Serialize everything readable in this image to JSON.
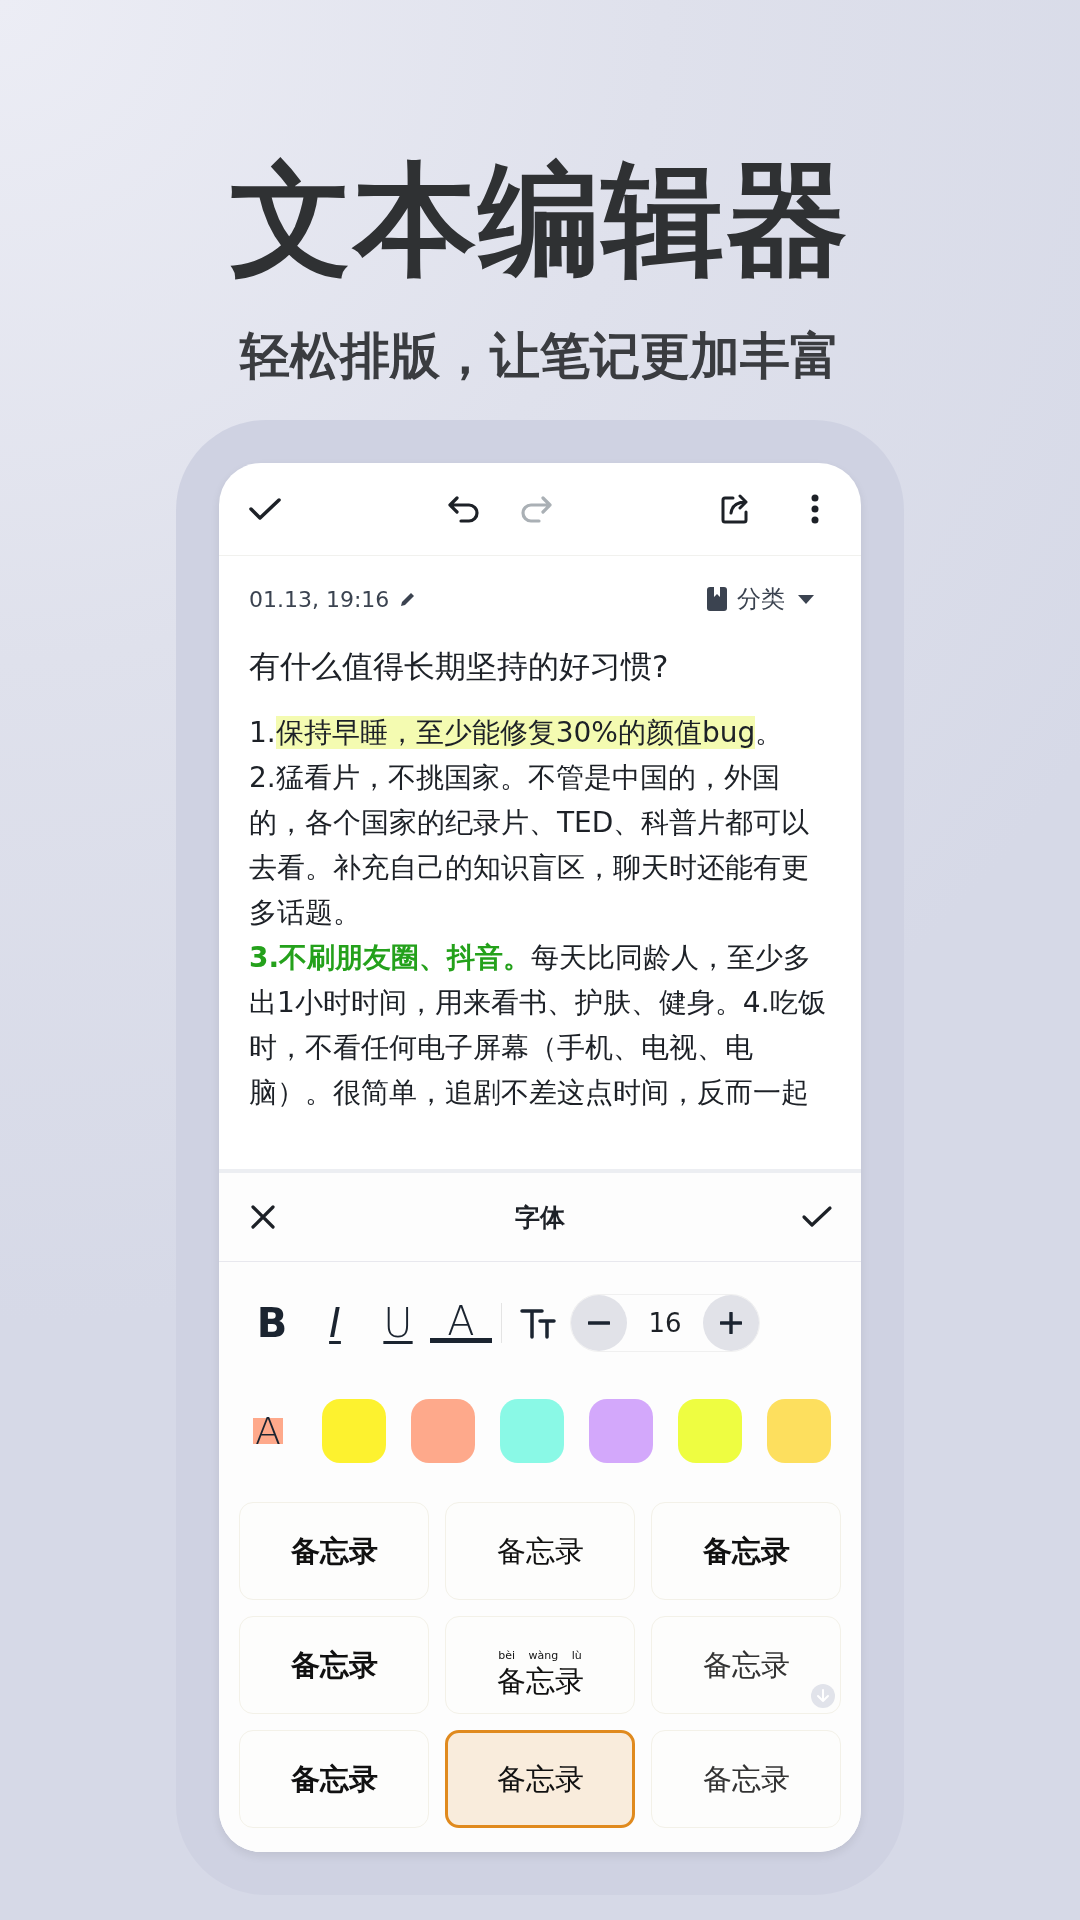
{
  "headline": "文本编辑器",
  "subtitle": "轻松排版，让笔记更加丰富",
  "toolbar": [
    {
      "kind": "undo",
      "disabled": false
    },
    {
      "kind": "redo",
      "disabled": true
    }
  ],
  "note": {
    "date": "01.13, 19:16",
    "category": "分类",
    "title": "有什么值得长期坚持的好习惯?",
    "paragraphs": [
      {
        "segments": [
          {
            "text": "1.",
            "kind": "plain"
          },
          {
            "text": "保持早睡，至少能修复30%的颜值bug",
            "kind": "highlight"
          },
          {
            "text": "。",
            "kind": "plain"
          }
        ]
      },
      {
        "segments": [
          {
            "text": "2.猛看片，不挑国家。不管是中国的，外国的，各个国家的纪录片、TED、科普片都可以去看。补充自己的知识盲区，聊天时还能有更多话题。",
            "kind": "plain"
          }
        ]
      },
      {
        "segments": [
          {
            "text": "3.不刷朋友圈、抖音。",
            "kind": "emphasis"
          },
          {
            "text": "每天比同龄人，至少多出1小时时间，用来看书、护肤、健身。4.吃饭时，不看任何电子屏幕（手机、电视、电脑）。很简单，追剧不差这点时间，反而一起",
            "kind": "plain"
          }
        ]
      }
    ]
  },
  "panel": {
    "title": "字体",
    "format_buttons": [
      {
        "label": "B",
        "kind": "bold"
      },
      {
        "label": "I",
        "kind": "italic"
      },
      {
        "label": "U",
        "kind": "underline"
      },
      {
        "label": "A",
        "kind": "color"
      }
    ],
    "font_size": "16",
    "highlight_button": {
      "label": "A",
      "color": "#fea98b"
    },
    "swatches": [
      {
        "color": "#fdf22f"
      },
      {
        "color": "#fea98b"
      },
      {
        "color": "#8af9e6"
      },
      {
        "color": "#d3a8fb"
      },
      {
        "color": "#eefd41"
      },
      {
        "color": "#fddf5e"
      }
    ],
    "fonts": [
      {
        "label": "备忘录",
        "kind": "bold",
        "selected": false,
        "downloadable": false
      },
      {
        "label": "备忘录",
        "kind": "regular",
        "selected": false,
        "downloadable": false
      },
      {
        "label": "备忘录",
        "kind": "medium",
        "selected": false,
        "downloadable": false
      },
      {
        "label": "备忘录",
        "kind": "bold",
        "selected": false,
        "downloadable": false
      },
      {
        "label": "备忘录",
        "kind": "regular",
        "pinyin": "bèi wàng lù",
        "selected": false,
        "downloadable": false
      },
      {
        "label": "备忘录",
        "kind": "light",
        "selected": false,
        "downloadable": true
      },
      {
        "label": "备忘录",
        "kind": "bold",
        "selected": false,
        "downloadable": false
      },
      {
        "label": "备忘录",
        "kind": "regular",
        "selected": true,
        "downloadable": false
      },
      {
        "label": "备忘录",
        "kind": "light",
        "selected": false,
        "downloadable": false
      }
    ]
  }
}
